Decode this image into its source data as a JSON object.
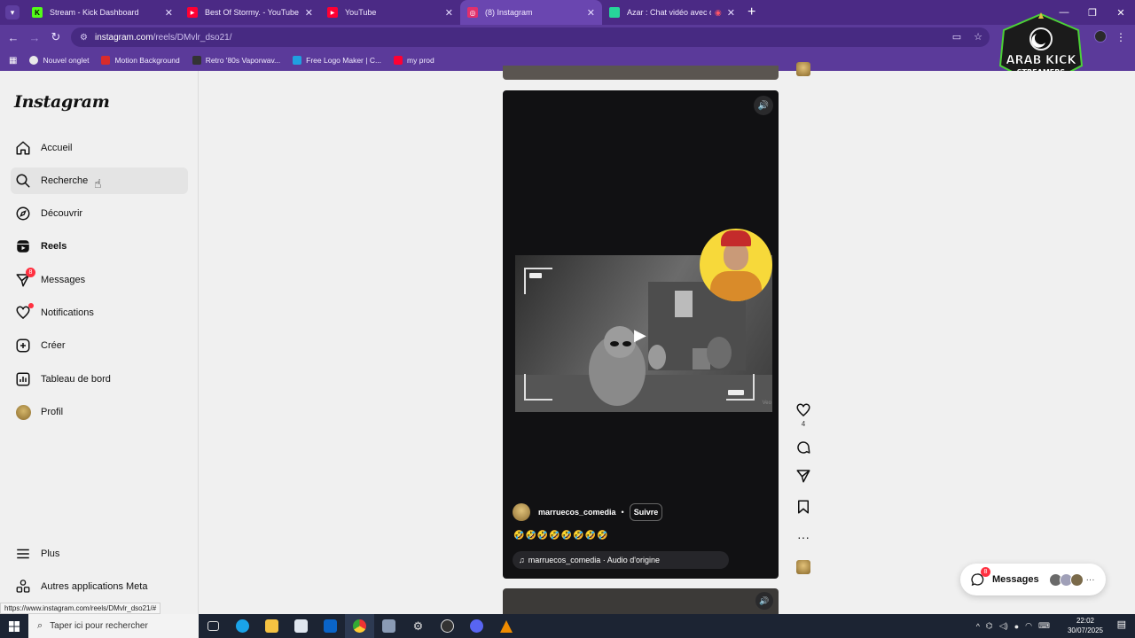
{
  "browser": {
    "tabs": [
      {
        "label": "Stream - Kick Dashboard",
        "fav_color": "#53fc18",
        "fav_text": "K",
        "active": false
      },
      {
        "label": "Best Of Stormy. - YouTube",
        "fav_color": "#ff0033",
        "fav_text": "▶",
        "active": false
      },
      {
        "label": "YouTube",
        "fav_color": "#ff0033",
        "fav_text": "▶",
        "active": false
      },
      {
        "label": "(8) Instagram",
        "fav_color": "#e1306c",
        "fav_text": "◎",
        "active": true
      },
      {
        "label": "Azar : Chat vidéo avec de n",
        "fav_color": "#27d59a",
        "fav_text": "",
        "active": false
      }
    ],
    "url_host": "instagram.com",
    "url_path": "/reels/DMvlr_dso21/",
    "bookmarks": [
      {
        "label": "Nouvel onglet",
        "color": "#e9e9e9"
      },
      {
        "label": "Motion Background",
        "color": "#d92b2b"
      },
      {
        "label": "Retro '80s Vaporwav...",
        "color": "#333333"
      },
      {
        "label": "Free Logo Maker | C...",
        "color": "#20a0e0"
      },
      {
        "label": "my prod",
        "color": "#ff0033"
      }
    ],
    "logo_top": "ARAB KICK",
    "logo_bottom": "STREAMERS"
  },
  "sidebar": {
    "logo": "Instagram",
    "items": [
      {
        "label": "Accueil",
        "icon": "home-icon"
      },
      {
        "label": "Recherche",
        "icon": "search-icon"
      },
      {
        "label": "Découvrir",
        "icon": "compass-icon"
      },
      {
        "label": "Reels",
        "icon": "reels-icon"
      },
      {
        "label": "Messages",
        "icon": "messenger-icon",
        "badge": "8"
      },
      {
        "label": "Notifications",
        "icon": "heart-icon"
      },
      {
        "label": "Créer",
        "icon": "plus-square-icon"
      },
      {
        "label": "Tableau de bord",
        "icon": "dashboard-icon"
      },
      {
        "label": "Profil",
        "icon": "avatar"
      }
    ],
    "bottom": [
      {
        "label": "Plus",
        "icon": "menu-icon"
      },
      {
        "label": "Autres applications Meta",
        "icon": "meta-apps-icon"
      }
    ]
  },
  "reel": {
    "username": "marruecos_comedia",
    "follow": "Suivre",
    "caption": "🤣🤣🤣🤣🤣🤣🤣🤣",
    "audio": "marruecos_comedia · Audio d'origine",
    "watermark": "Veo",
    "likes": "4"
  },
  "messages_pill": {
    "label": "Messages",
    "badge": "8"
  },
  "status_url": "https://www.instagram.com/reels/DMvlr_dso21/#",
  "taskbar": {
    "search_placeholder": "Taper ici pour rechercher",
    "time": "22:02",
    "date": "30/07/2025"
  }
}
